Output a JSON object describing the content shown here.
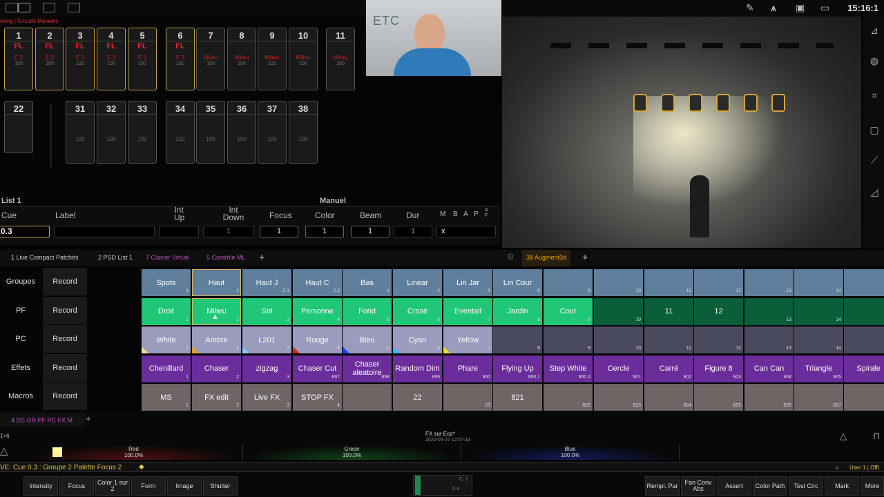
{
  "breadcrumb": "cking | Circuits Manuels",
  "clock": "15:16:1",
  "webcam": {
    "logo": "ETC"
  },
  "channels": {
    "row1": [
      {
        "num": "1",
        "lvl": "FL",
        "ref": "E 3",
        "sub": "100",
        "sel": true
      },
      {
        "num": "2",
        "lvl": "FL",
        "ref": "E 3",
        "sub": "100",
        "sel": true
      },
      {
        "num": "3",
        "lvl": "FL",
        "ref": "E 3",
        "sub": "100",
        "sel": true
      },
      {
        "num": "4",
        "lvl": "FL",
        "ref": "E 3",
        "sub": "100",
        "sel": true
      },
      {
        "num": "5",
        "lvl": "FL",
        "ref": "E 3",
        "sub": "100",
        "sel": true
      },
      {
        "num": "6",
        "lvl": "FL",
        "ref": "E 3",
        "sub": "100",
        "sel": true
      },
      {
        "num": "7",
        "lvl": "",
        "ref": "Milieu",
        "sub": "100",
        "sel": false
      },
      {
        "num": "8",
        "lvl": "",
        "ref": "Milieu",
        "sub": "100",
        "sel": false
      },
      {
        "num": "9",
        "lvl": "",
        "ref": "Milieu",
        "sub": "100",
        "sel": false
      },
      {
        "num": "10",
        "lvl": "",
        "ref": "Milieu",
        "sub": "100",
        "sel": false
      },
      {
        "num": "11",
        "lvl": "",
        "ref": "Milieu",
        "sub": "100",
        "sel": false
      }
    ],
    "row2": [
      {
        "num": "22",
        "mid": ""
      },
      {
        "num": "31",
        "mid": "100"
      },
      {
        "num": "32",
        "mid": "100"
      },
      {
        "num": "33",
        "mid": "100"
      },
      {
        "num": "34",
        "mid": "100"
      },
      {
        "num": "35",
        "mid": "100"
      },
      {
        "num": "36",
        "mid": "100"
      },
      {
        "num": "37",
        "mid": "100"
      },
      {
        "num": "38",
        "mid": "100"
      }
    ]
  },
  "cuelist": {
    "list": "List 1",
    "mode": "Manuel",
    "headers": {
      "cue": "Cue",
      "label": "Label",
      "int_up": "Int Up",
      "int_down": "Int Down",
      "focus": "Focus",
      "color": "Color",
      "beam": "Beam",
      "dur": "Dur",
      "m": "M",
      "b": "B",
      "a": "A",
      "p": "P",
      "af": "A F"
    },
    "values": {
      "cue": "0.3",
      "int_down": "1",
      "focus": "1",
      "color": "1",
      "beam": "1",
      "dur": "1",
      "flag": "x"
    }
  },
  "tabs": [
    {
      "label": "1 Live Compact  Patchés",
      "color": "#ccc"
    },
    {
      "label": "2 PSD List 1",
      "color": "#ccc"
    },
    {
      "label": "7 Clavier Virtuel",
      "color": "#b84fb8"
    },
    {
      "label": "5 Contrôle ML",
      "color": "#b84fb8"
    },
    {
      "label": "+",
      "color": "#ccc"
    },
    {
      "label": "38 Augment3d",
      "color": "#e8a200"
    },
    {
      "label": "+",
      "color": "#ccc"
    }
  ],
  "rows": [
    {
      "label": "Groupes",
      "rec": "Record",
      "color": "#5f7f9c",
      "cells": [
        {
          "t": "Spots",
          "n": "1"
        },
        {
          "t": "Haut",
          "n": "2",
          "sel": true
        },
        {
          "t": "Haut J",
          "n": "2.1"
        },
        {
          "t": "Haut C",
          "n": "2.2"
        },
        {
          "t": "Bas",
          "n": "3"
        },
        {
          "t": "Linear",
          "n": "4"
        },
        {
          "t": "Lin Jar",
          "n": "5"
        },
        {
          "t": "Lin Cour",
          "n": "6"
        },
        {
          "t": "",
          "n": "9"
        },
        {
          "t": "",
          "n": "10"
        },
        {
          "t": "",
          "n": "11"
        },
        {
          "t": "",
          "n": "12"
        },
        {
          "t": "",
          "n": "13"
        },
        {
          "t": "",
          "n": "14"
        },
        {
          "t": "",
          "n": ""
        }
      ]
    },
    {
      "label": "PF",
      "rec": "Record",
      "color": "#1fc776",
      "dim": "#0a5e3a",
      "cells": [
        {
          "t": "Droit",
          "n": "1"
        },
        {
          "t": "Milieu",
          "n": "2",
          "sel": true
        },
        {
          "t": "Sol",
          "n": "3"
        },
        {
          "t": "Personne",
          "n": "4"
        },
        {
          "t": "Fond",
          "n": "5"
        },
        {
          "t": "Crosé",
          "n": "6"
        },
        {
          "t": "Eventail",
          "n": "7"
        },
        {
          "t": "Jardin",
          "n": "8"
        },
        {
          "t": "Cour",
          "n": "9"
        },
        {
          "t": "",
          "n": "10",
          "dim": true
        },
        {
          "t": "11",
          "n": "",
          "dim": true
        },
        {
          "t": "12",
          "n": "",
          "dim": true
        },
        {
          "t": "",
          "n": "13",
          "dim": true
        },
        {
          "t": "",
          "n": "14",
          "dim": true
        },
        {
          "t": "",
          "n": "",
          "dim": true
        }
      ]
    },
    {
      "label": "PC",
      "rec": "Record",
      "color": "#9b9bbd",
      "dim": "#4a4a5e",
      "cells": [
        {
          "t": "White",
          "n": "1",
          "tri": "#f5e08a"
        },
        {
          "t": "Ambre",
          "n": "2",
          "tri": "#e8a020"
        },
        {
          "t": "L201",
          "n": "3",
          "tri": "#8fc6ff"
        },
        {
          "t": "Rouge",
          "n": "4",
          "tri": "#e02020"
        },
        {
          "t": "Bleu",
          "n": "5",
          "tri": "#2040ff"
        },
        {
          "t": "Cyan",
          "n": "6",
          "tri": "#20c0ff"
        },
        {
          "t": "Yellow",
          "n": "7",
          "tri": "#f0e020"
        },
        {
          "t": "",
          "n": "8",
          "dim": true
        },
        {
          "t": "",
          "n": "9",
          "dim": true
        },
        {
          "t": "",
          "n": "10",
          "dim": true
        },
        {
          "t": "",
          "n": "11",
          "dim": true
        },
        {
          "t": "",
          "n": "12",
          "dim": true
        },
        {
          "t": "",
          "n": "13",
          "dim": true
        },
        {
          "t": "",
          "n": "14",
          "dim": true
        },
        {
          "t": "",
          "n": "",
          "dim": true
        }
      ]
    },
    {
      "label": "Effets",
      "rec": "Record",
      "color": "#6b2d9c",
      "cells": [
        {
          "t": "Chenillard",
          "n": "1"
        },
        {
          "t": "Chaser",
          "n": "2"
        },
        {
          "t": "zigzag",
          "n": "3"
        },
        {
          "t": "Chaser Cut",
          "n": "897"
        },
        {
          "t": "Chaser aleatoire",
          "n": "898"
        },
        {
          "t": "Random Dim",
          "n": "899"
        },
        {
          "t": "Phare",
          "n": "900"
        },
        {
          "t": "Flying Up",
          "n": "900.1"
        },
        {
          "t": "Step White",
          "n": "900.2"
        },
        {
          "t": "Cercle",
          "n": "901"
        },
        {
          "t": "Carré",
          "n": "902"
        },
        {
          "t": "Figure 8",
          "n": "903"
        },
        {
          "t": "Can Can",
          "n": "904"
        },
        {
          "t": "Triangle",
          "n": "905"
        },
        {
          "t": "Spirale",
          "n": ""
        }
      ]
    },
    {
      "label": "Macros",
      "rec": "Record",
      "color": "#6e6564",
      "cells": [
        {
          "t": "MS",
          "n": "1"
        },
        {
          "t": "FX edit",
          "n": "2"
        },
        {
          "t": "Live FX",
          "n": "3"
        },
        {
          "t": "STOP FX",
          "n": "4"
        },
        {
          "t": "",
          "n": ""
        },
        {
          "t": "22",
          "n": ""
        },
        {
          "t": "",
          "n": "23"
        },
        {
          "t": "821",
          "n": ""
        },
        {
          "t": "",
          "n": "822"
        },
        {
          "t": "",
          "n": "823"
        },
        {
          "t": "",
          "n": "824"
        },
        {
          "t": "",
          "n": "825"
        },
        {
          "t": "",
          "n": "826"
        },
        {
          "t": "",
          "n": "827"
        },
        {
          "t": "",
          "n": ""
        }
      ]
    }
  ],
  "bottom": {
    "tab": "4 DS GR PF PC FX M",
    "range": "1>6",
    "show": "FX sur Eos*",
    "date": "2020-05-27 12:57:13",
    "colors": [
      {
        "name": "Red",
        "val": "100.0%",
        "c": "#e02020"
      },
      {
        "name": "Green",
        "val": "100.0%",
        "c": "#20c040"
      },
      {
        "name": "Blue",
        "val": "100.0%",
        "c": "#2040ff"
      }
    ],
    "cmdline": "VE: Cue  0.3 :  Groupe 2 Palette Focus 2",
    "user": "User 1 | Offl"
  },
  "softkeys": [
    {
      "l": "Intensity"
    },
    {
      "l": "Focus"
    },
    {
      "l": "Color 1 sur 2"
    },
    {
      "l": "Form"
    },
    {
      "l": "Image"
    },
    {
      "l": "Shutter"
    },
    {
      "l": "Rempl. Par"
    },
    {
      "l": "Fan Conv Abs"
    },
    {
      "l": "Assert"
    },
    {
      "l": "Color Path"
    },
    {
      "l": "Test Circ"
    },
    {
      "l": "Mark"
    },
    {
      "l": "More"
    }
  ]
}
